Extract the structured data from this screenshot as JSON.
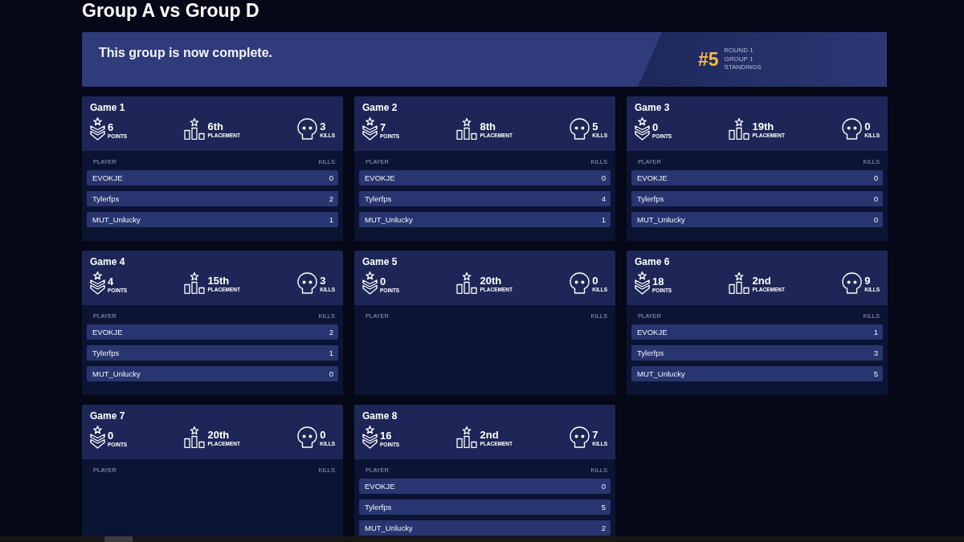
{
  "page": {
    "title": "Group A vs Group D"
  },
  "banner": {
    "message": "This group is now complete.",
    "rank": "#5",
    "details": [
      "ROUND 1",
      "GROUP 1",
      "STANDINGS"
    ]
  },
  "games": [
    {
      "title": "Game 1",
      "stats": [
        {
          "kind": "points",
          "value": "6",
          "label": "POINTS"
        },
        {
          "kind": "placement",
          "value": "6th",
          "label": "PLACEMENT"
        },
        {
          "kind": "kills",
          "value": "3",
          "label": "KILLS"
        }
      ],
      "columns": [
        "PLAYER",
        "KILLS"
      ],
      "players": [
        {
          "name": "EVOKJE",
          "kills": "0"
        },
        {
          "name": "Tylerfps",
          "kills": "2"
        },
        {
          "name": "MUT_Unlucky",
          "kills": "1"
        }
      ]
    },
    {
      "title": "Game 2",
      "stats": [
        {
          "kind": "points",
          "value": "7",
          "label": "POINTS"
        },
        {
          "kind": "placement",
          "value": "8th",
          "label": "PLACEMENT"
        },
        {
          "kind": "kills",
          "value": "5",
          "label": "KILLS"
        }
      ],
      "columns": [
        "PLAYER",
        "KILLS"
      ],
      "players": [
        {
          "name": "EVOKJE",
          "kills": "0"
        },
        {
          "name": "Tylerfps",
          "kills": "4"
        },
        {
          "name": "MUT_Unlucky",
          "kills": "1"
        }
      ]
    },
    {
      "title": "Game 3",
      "stats": [
        {
          "kind": "points",
          "value": "0",
          "label": "POINTS"
        },
        {
          "kind": "placement",
          "value": "19th",
          "label": "PLACEMENT"
        },
        {
          "kind": "kills",
          "value": "0",
          "label": "KILLS"
        }
      ],
      "columns": [
        "PLAYER",
        "KILLS"
      ],
      "players": [
        {
          "name": "EVOKJE",
          "kills": "0"
        },
        {
          "name": "Tylerfps",
          "kills": "0"
        },
        {
          "name": "MUT_Unlucky",
          "kills": "0"
        }
      ]
    },
    {
      "title": "Game 4",
      "stats": [
        {
          "kind": "points",
          "value": "4",
          "label": "POINTS"
        },
        {
          "kind": "placement",
          "value": "15th",
          "label": "PLACEMENT"
        },
        {
          "kind": "kills",
          "value": "3",
          "label": "KILLS"
        }
      ],
      "columns": [
        "PLAYER",
        "KILLS"
      ],
      "players": [
        {
          "name": "EVOKJE",
          "kills": "2"
        },
        {
          "name": "Tylerfps",
          "kills": "1"
        },
        {
          "name": "MUT_Unlucky",
          "kills": "0"
        }
      ]
    },
    {
      "title": "Game 5",
      "stats": [
        {
          "kind": "points",
          "value": "0",
          "label": "POINTS"
        },
        {
          "kind": "placement",
          "value": "20th",
          "label": "PLACEMENT"
        },
        {
          "kind": "kills",
          "value": "0",
          "label": "KILLS"
        }
      ],
      "columns": [
        "PLAYER",
        "KILLS"
      ]
    },
    {
      "title": "Game 6",
      "stats": [
        {
          "kind": "points",
          "value": "18",
          "label": "POINTS"
        },
        {
          "kind": "placement",
          "value": "2nd",
          "label": "PLACEMENT"
        },
        {
          "kind": "kills",
          "value": "9",
          "label": "KILLS"
        }
      ],
      "columns": [
        "PLAYER",
        "KILLS"
      ],
      "players": [
        {
          "name": "EVOKJE",
          "kills": "1"
        },
        {
          "name": "Tylerfps",
          "kills": "3"
        },
        {
          "name": "MUT_Unlucky",
          "kills": "5"
        }
      ]
    },
    {
      "title": "Game 7",
      "stats": [
        {
          "kind": "points",
          "value": "0",
          "label": "POINTS"
        },
        {
          "kind": "placement",
          "value": "20th",
          "label": "PLACEMENT"
        },
        {
          "kind": "kills",
          "value": "0",
          "label": "KILLS"
        }
      ],
      "columns": [
        "PLAYER",
        "KILLS"
      ]
    },
    {
      "title": "Game 8",
      "stats": [
        {
          "kind": "points",
          "value": "16",
          "label": "POINTS"
        },
        {
          "kind": "placement",
          "value": "2nd",
          "label": "PLACEMENT"
        },
        {
          "kind": "kills",
          "value": "7",
          "label": "KILLS"
        }
      ],
      "columns": [
        "PLAYER",
        "KILLS"
      ],
      "players": [
        {
          "name": "EVOKJE",
          "kills": "0"
        },
        {
          "name": "Tylerfps",
          "kills": "5"
        },
        {
          "name": "MUT_Unlucky",
          "kills": "2"
        }
      ]
    }
  ]
}
